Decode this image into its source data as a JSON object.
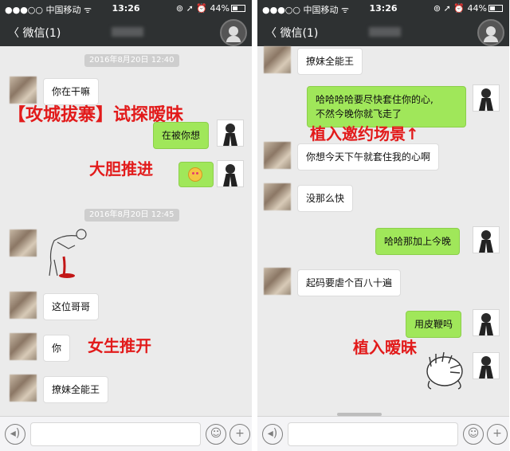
{
  "colors": {
    "nav_bg": "#2e3132",
    "chat_bg": "#ebebeb",
    "bubble_out": "#a0e75a",
    "bubble_in": "#ffffff",
    "overlay_red": "#e21b1b"
  },
  "status": {
    "carrier": "●●●○○ 中国移动 ᯤ",
    "time": "13:26",
    "battery": "⊚ ➚ ⏰ 44%"
  },
  "nav": {
    "back_label": "〈 微信(1)"
  },
  "left": {
    "timestamp1": "2016年8月20日 12:40",
    "timestamp2": "2016年8月20日 12:45",
    "msg1": "你在干嘛",
    "msg2": "在被你想",
    "msg4": "这位哥哥",
    "msg5": "你",
    "msg6": "撩妹全能王",
    "overlay1": "【攻城拔寨】试探暧昧",
    "overlay2": "大胆推进",
    "overlay3": "女生推开"
  },
  "right": {
    "msg1": "撩妹全能王",
    "msg2_line1": "哈哈哈哈要尽快套住你的心,",
    "msg2_line2": "不然今晚你就飞走了",
    "msg3": "你想今天下午就套住我的心啊",
    "msg4": "没那么快",
    "msg5": "哈哈那加上今晚",
    "msg6": "起码要虐个百八十遍",
    "msg7": "用皮鞭吗",
    "overlay1": "植入邀约场景↑",
    "overlay2": "植入暧昧"
  },
  "icons": {
    "voice": "◂)",
    "emoji": "☺",
    "add": "+"
  }
}
